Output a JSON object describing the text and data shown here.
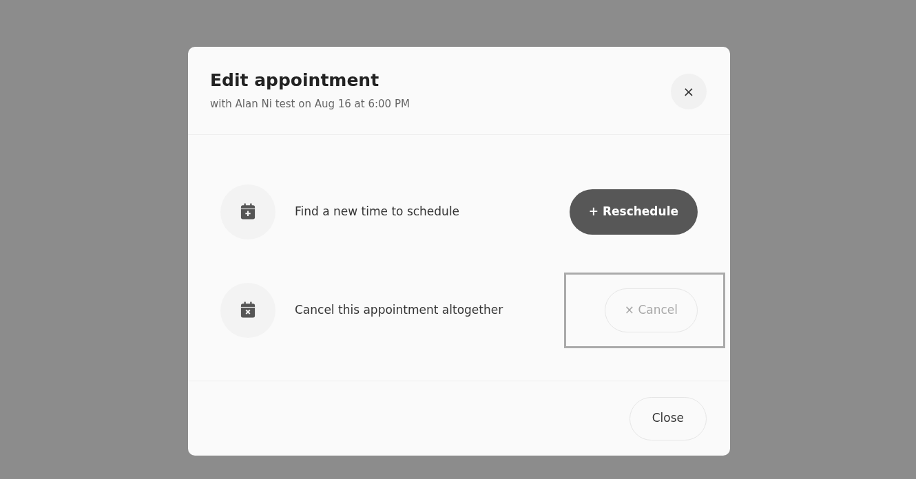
{
  "dialog": {
    "title": "Edit appointment",
    "subtitle": "with Alan Ni test on Aug 16 at 6:00 PM",
    "close_symbol": "×"
  },
  "actions": [
    {
      "kind": "reschedule",
      "description": "Find a new time to schedule",
      "button": "+ Reschedule",
      "disabled": false,
      "highlighted": false
    },
    {
      "kind": "cancel",
      "description": "Cancel this appointment altogether",
      "button": "× Cancel",
      "disabled": true,
      "highlighted": true
    }
  ],
  "footer": {
    "button": "Close"
  }
}
